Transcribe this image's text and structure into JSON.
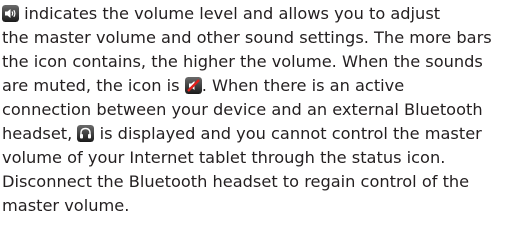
{
  "doc": {
    "lines": [
      {
        "before": "",
        "icon": "speaker-volume-icon",
        "after": " indicates the volume level and allows you to adjust"
      },
      {
        "before": "the master volume and other sound settings. The more bars",
        "icon": "",
        "after": ""
      },
      {
        "before": "the icon contains, the higher the volume. When the sounds",
        "icon": "",
        "after": ""
      },
      {
        "before": "are muted, the icon is ",
        "icon": "muted-speaker-icon",
        "after": ". When there is an active"
      },
      {
        "before": "connection between your device and an external Bluetooth",
        "icon": "",
        "after": ""
      },
      {
        "before": "headset, ",
        "icon": "headset-icon",
        "after": " is displayed and you cannot control the master"
      },
      {
        "before": "volume of your Internet tablet through the status icon.",
        "icon": "",
        "after": ""
      },
      {
        "before": "Disconnect the Bluetooth headset to regain control of the",
        "icon": "",
        "after": ""
      },
      {
        "before": "master volume.",
        "icon": "",
        "after": ""
      }
    ]
  }
}
